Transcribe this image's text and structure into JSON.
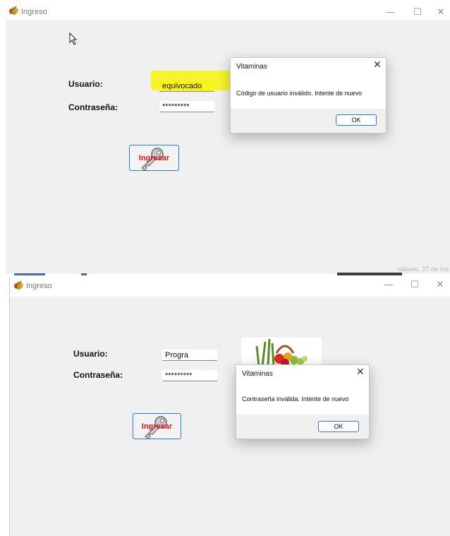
{
  "top": {
    "window_title": "Ingreso",
    "controls": {
      "minimize": "—",
      "maximize": "☐",
      "close": "✕"
    },
    "usuario_label": "Usuario:",
    "usuario_value": "equivocado",
    "contrasena_label": "Contraseña:",
    "contrasena_value": "*********",
    "ingresar_label": "Ingresar",
    "dialog": {
      "title": "Vitaminas",
      "close": "✕",
      "message": "Código de usuario inválido. Intente de nuevo",
      "ok": "OK"
    },
    "taskbar_date": "sábado, 27 de ma"
  },
  "bottom": {
    "window_title": "Ingreso",
    "controls": {
      "minimize": "—",
      "maximize": "☐",
      "close": "✕"
    },
    "usuario_label": "Usuario:",
    "usuario_value": "Progra",
    "contrasena_label": "Contraseña:",
    "contrasena_value": "*********",
    "ingresar_label": "Ingresar",
    "dialog": {
      "title": "Vitaminas",
      "close": "✕",
      "message": "Contraseña inválida. Intente de nuevo",
      "ok": "OK"
    }
  },
  "colors": {
    "accent": "#2a78c2",
    "ingresar_text": "#d9101a",
    "highlight": "#f5f51a",
    "window_bg": "#f0f0f0"
  }
}
